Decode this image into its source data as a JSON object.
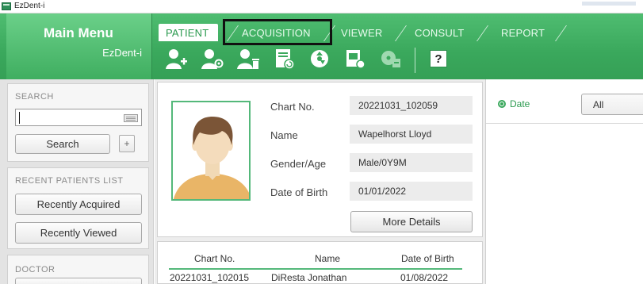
{
  "window": {
    "title": "EzDent-i"
  },
  "main_menu": {
    "title": "Main Menu",
    "subtitle": "EzDent-i"
  },
  "tabs": [
    {
      "label": "PATIENT",
      "active": true
    },
    {
      "label": "ACQUISITION",
      "active": false
    },
    {
      "label": "VIEWER",
      "active": false
    },
    {
      "label": "CONSULT",
      "active": false
    },
    {
      "label": "REPORT",
      "active": false
    }
  ],
  "toolbar": {
    "icons": [
      "add-patient-icon",
      "search-patient-icon",
      "delete-patient-icon",
      "import-image-icon",
      "cd-burn-icon",
      "image-folder-icon",
      "export-icon",
      "help-icon"
    ],
    "help_label": "?"
  },
  "sidebar": {
    "search": {
      "title": "SEARCH",
      "value": "",
      "button": "Search",
      "plus": "+"
    },
    "recent": {
      "title": "RECENT PATIENTS LIST",
      "acquired": "Recently Acquired",
      "viewed": "Recently Viewed"
    },
    "doctor": {
      "title": "DOCTOR"
    }
  },
  "patient": {
    "chart_no_label": "Chart No.",
    "chart_no": "20221031_102059",
    "name_label": "Name",
    "name": "Wapelhorst Lloyd",
    "gender_age_label": "Gender/Age",
    "gender_age": "Male/0Y9M",
    "dob_label": "Date of Birth",
    "dob": "01/01/2022",
    "more_details": "More Details"
  },
  "patient_list": {
    "headers": [
      "Chart No.",
      "Name",
      "Date of Birth"
    ],
    "rows": [
      [
        "20221031_102015",
        "DiResta Jonathan",
        "01/08/2022"
      ]
    ]
  },
  "filter": {
    "label": "Date",
    "selected": "All"
  },
  "colors": {
    "accent": "#3aa85c",
    "accent_light": "#54b87a"
  }
}
